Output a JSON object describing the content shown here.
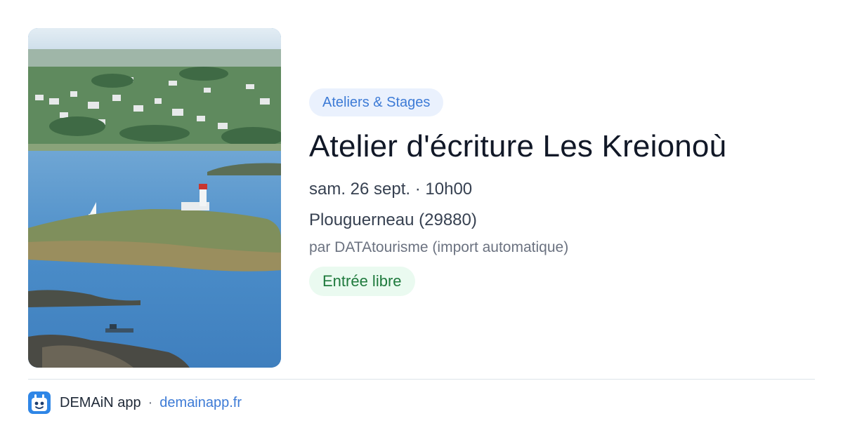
{
  "hero": {
    "image_description": "coastal-lighthouse-photo"
  },
  "event": {
    "category": "Ateliers & Stages",
    "title": "Atelier d'écriture Les Kreionoù",
    "date": "sam. 26 sept. · 10h00",
    "location": "Plouguerneau (29880)",
    "source": "par DATAtourisme (import automatique)",
    "price": "Entrée libre"
  },
  "footer": {
    "app_name": "DEMAiN app",
    "separator": "·",
    "domain": "demainapp.fr",
    "logo_icon": "demain-logo-icon"
  },
  "colors": {
    "accent_blue": "#3d7bd6",
    "category_bg": "#eaf1fd",
    "price_green": "#1f7a3d",
    "price_bg": "#eafaf0",
    "title": "#111827"
  }
}
